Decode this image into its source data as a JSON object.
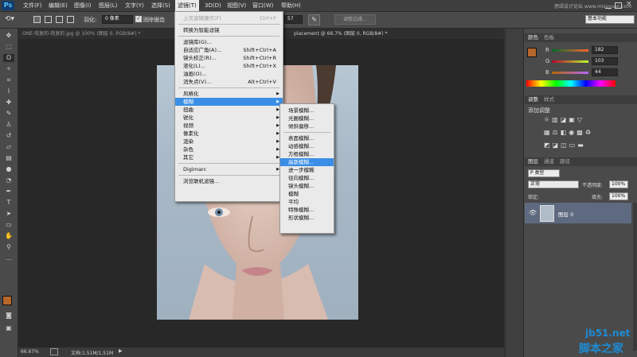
{
  "app": {
    "logo": "Ps"
  },
  "menubar": {
    "items": [
      "文件(F)",
      "编辑(E)",
      "图像(I)",
      "图层(L)",
      "文字(Y)",
      "选择(S)",
      "滤镜(T)",
      "3D(D)",
      "视图(V)",
      "窗口(W)",
      "帮助(H)"
    ],
    "active": "滤镜(T)",
    "watermark": "思绿设计论坛 www.missyuan.com"
  },
  "options": {
    "feather_label": "羽化:",
    "feather_value": "0 像素",
    "antialias_label": "消除锯齿",
    "size_value": "57",
    "refine_button": "调整边缘...",
    "workspace": "基本功能"
  },
  "tabs": [
    "ONE-恢复的-恢复的.jpg @ 100% (图层 0, RGB/8#) *",
    "placement @ 66.7% (图层 0, RGB/8#) *"
  ],
  "status": {
    "zoom": "66.67%",
    "doc": "文档:1.51M/1.51M"
  },
  "filter_menu": {
    "items": [
      {
        "label": "上次滤镜操作(F)",
        "shortcut": "Ctrl+F",
        "disabled": true
      },
      {
        "sep": true
      },
      {
        "label": "转换为智能滤镜"
      },
      {
        "sep": true
      },
      {
        "label": "滤镜库(G)..."
      },
      {
        "label": "自适应广角(A)...",
        "shortcut": "Shift+Ctrl+A"
      },
      {
        "label": "镜头校正(R)...",
        "shortcut": "Shift+Ctrl+R"
      },
      {
        "label": "液化(L)...",
        "shortcut": "Shift+Ctrl+X"
      },
      {
        "label": "油画(O)..."
      },
      {
        "label": "消失点(V)...",
        "shortcut": "Alt+Ctrl+V"
      },
      {
        "sep": true
      },
      {
        "label": "风格化",
        "sub": true
      },
      {
        "label": "模糊",
        "sub": true,
        "hl": true
      },
      {
        "label": "扭曲",
        "sub": true
      },
      {
        "label": "锐化",
        "sub": true
      },
      {
        "label": "视频",
        "sub": true
      },
      {
        "label": "像素化",
        "sub": true
      },
      {
        "label": "渲染",
        "sub": true
      },
      {
        "label": "杂色",
        "sub": true
      },
      {
        "label": "其它",
        "sub": true
      },
      {
        "sep": true
      },
      {
        "label": "Digimarc",
        "sub": true
      },
      {
        "sep": true
      },
      {
        "label": "浏览联机滤镜..."
      }
    ]
  },
  "blur_submenu": {
    "items": [
      {
        "label": "场景模糊..."
      },
      {
        "label": "光圈模糊..."
      },
      {
        "label": "倾斜偏移..."
      },
      {
        "sep": true
      },
      {
        "label": "表面模糊..."
      },
      {
        "label": "动感模糊..."
      },
      {
        "label": "方框模糊..."
      },
      {
        "label": "高斯模糊...",
        "hl": true
      },
      {
        "label": "进一步模糊"
      },
      {
        "label": "径向模糊..."
      },
      {
        "label": "镜头模糊..."
      },
      {
        "label": "模糊"
      },
      {
        "label": "平均"
      },
      {
        "label": "特殊模糊..."
      },
      {
        "label": "形状模糊..."
      }
    ]
  },
  "color_panel": {
    "tabs": [
      "颜色",
      "色板"
    ],
    "r_label": "R",
    "g_label": "G",
    "b_label": "B",
    "r": "182",
    "g": "103",
    "b": "44",
    "swatch": "#b6672c"
  },
  "adjust_panel": {
    "tabs": [
      "调整",
      "样式"
    ],
    "title": "添加调整"
  },
  "layers_panel": {
    "tabs": [
      "图层",
      "通道",
      "路径"
    ],
    "kind": "P 类型",
    "blend": "正常",
    "opacity_label": "不透明度:",
    "opacity": "100%",
    "lock_label": "锁定:",
    "fill_label": "填充:",
    "fill": "100%",
    "layer_name": "图层 0"
  },
  "watermark_br": {
    "line1": "jb51.net",
    "line2": "脚本之家"
  }
}
